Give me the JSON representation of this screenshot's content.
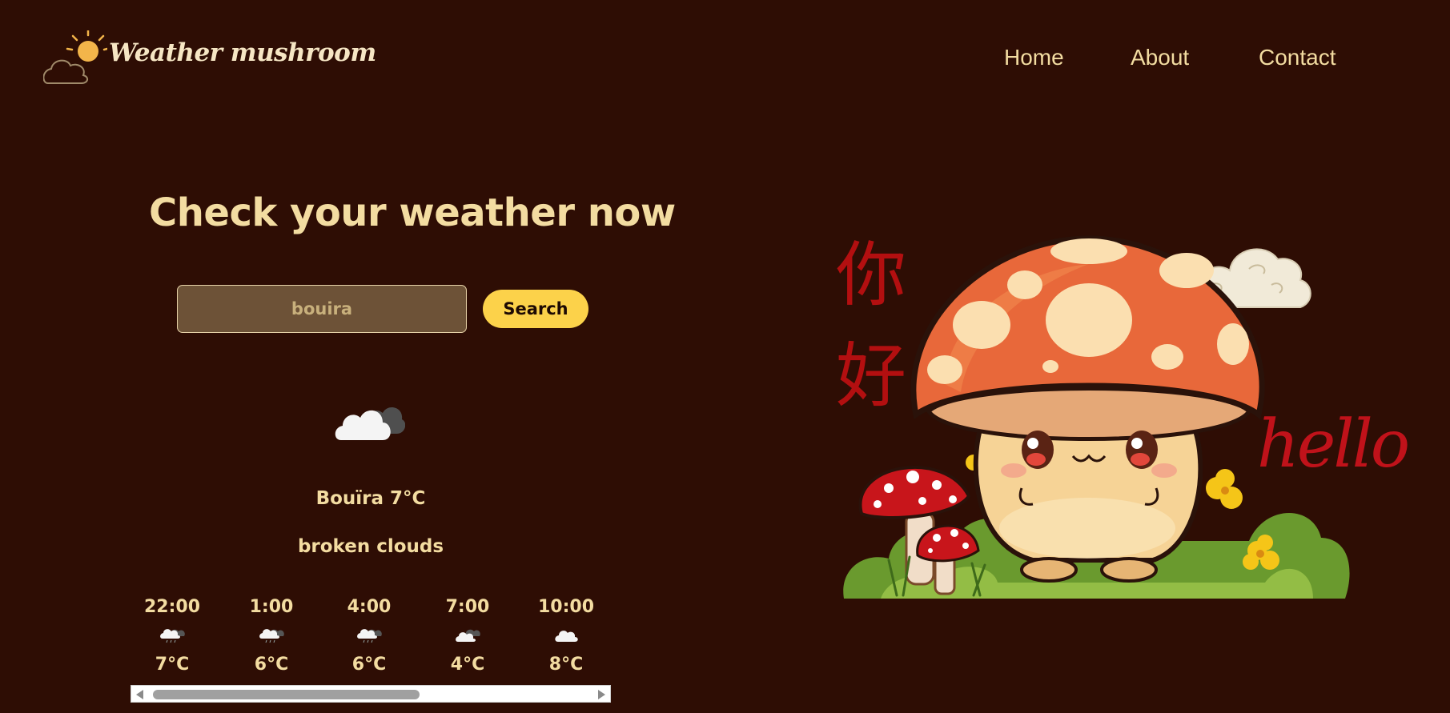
{
  "brand": {
    "name": "Weather mushroom"
  },
  "nav": {
    "items": [
      "Home",
      "About",
      "Contact"
    ]
  },
  "hero": {
    "headline": "Check your weather now"
  },
  "search": {
    "value": "bouira",
    "button_label": "Search"
  },
  "current": {
    "icon": "broken-clouds-icon",
    "city_temp": "Bouïra 7°C",
    "description": "broken clouds"
  },
  "forecast": [
    {
      "time": "22:00",
      "icon": "rain-cloud-icon",
      "temp": "7°C"
    },
    {
      "time": "1:00",
      "icon": "rain-cloud-icon",
      "temp": "6°C"
    },
    {
      "time": "4:00",
      "icon": "rain-cloud-icon",
      "temp": "6°C"
    },
    {
      "time": "7:00",
      "icon": "broken-clouds-icon",
      "temp": "4°C"
    },
    {
      "time": "10:00",
      "icon": "cloud-icon",
      "temp": "8°C"
    }
  ],
  "illustration": {
    "text_chinese_1": "你",
    "text_chinese_2": "好",
    "text_english": "hello"
  },
  "colors": {
    "background": "#2e0d04",
    "accent": "#fcd24a",
    "text": "#f3dca1",
    "input_bg": "#6d5237"
  }
}
